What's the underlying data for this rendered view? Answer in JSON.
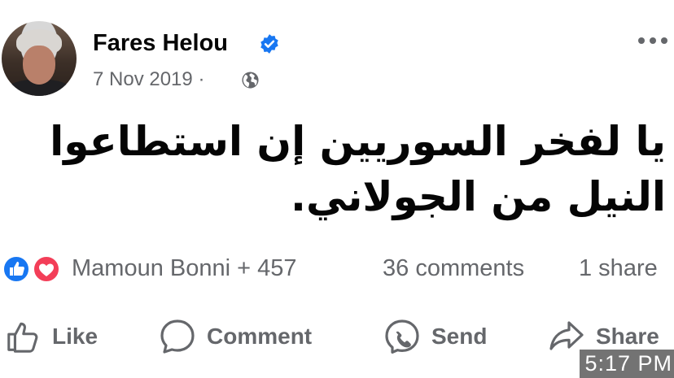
{
  "post": {
    "author": "Fares Helou",
    "date": "7 Nov 2019",
    "separator": "·",
    "text": "يا لفخر السوريين إن استطاعوا النيل من الجولاني."
  },
  "stats": {
    "reactors": "Mamoun Bonni + 457",
    "comments": "36 comments",
    "shares": "1 share"
  },
  "actions": {
    "like": "Like",
    "comment": "Comment",
    "send": "Send",
    "share": "Share"
  },
  "overlay": {
    "time": "5:17 PM"
  },
  "icons": {
    "verified": "verified-badge-icon",
    "audience": "globe-icon",
    "menu": "more-options-icon",
    "like_reaction": "like-reaction-icon",
    "love_reaction": "love-reaction-icon",
    "like": "thumbs-up-icon",
    "comment": "speech-bubble-icon",
    "send": "messenger-icon",
    "share": "share-arrow-icon"
  },
  "colors": {
    "text": "#050505",
    "secondary": "#65676b",
    "facebook_blue": "#1877f2",
    "love_red": "#f33e58"
  }
}
